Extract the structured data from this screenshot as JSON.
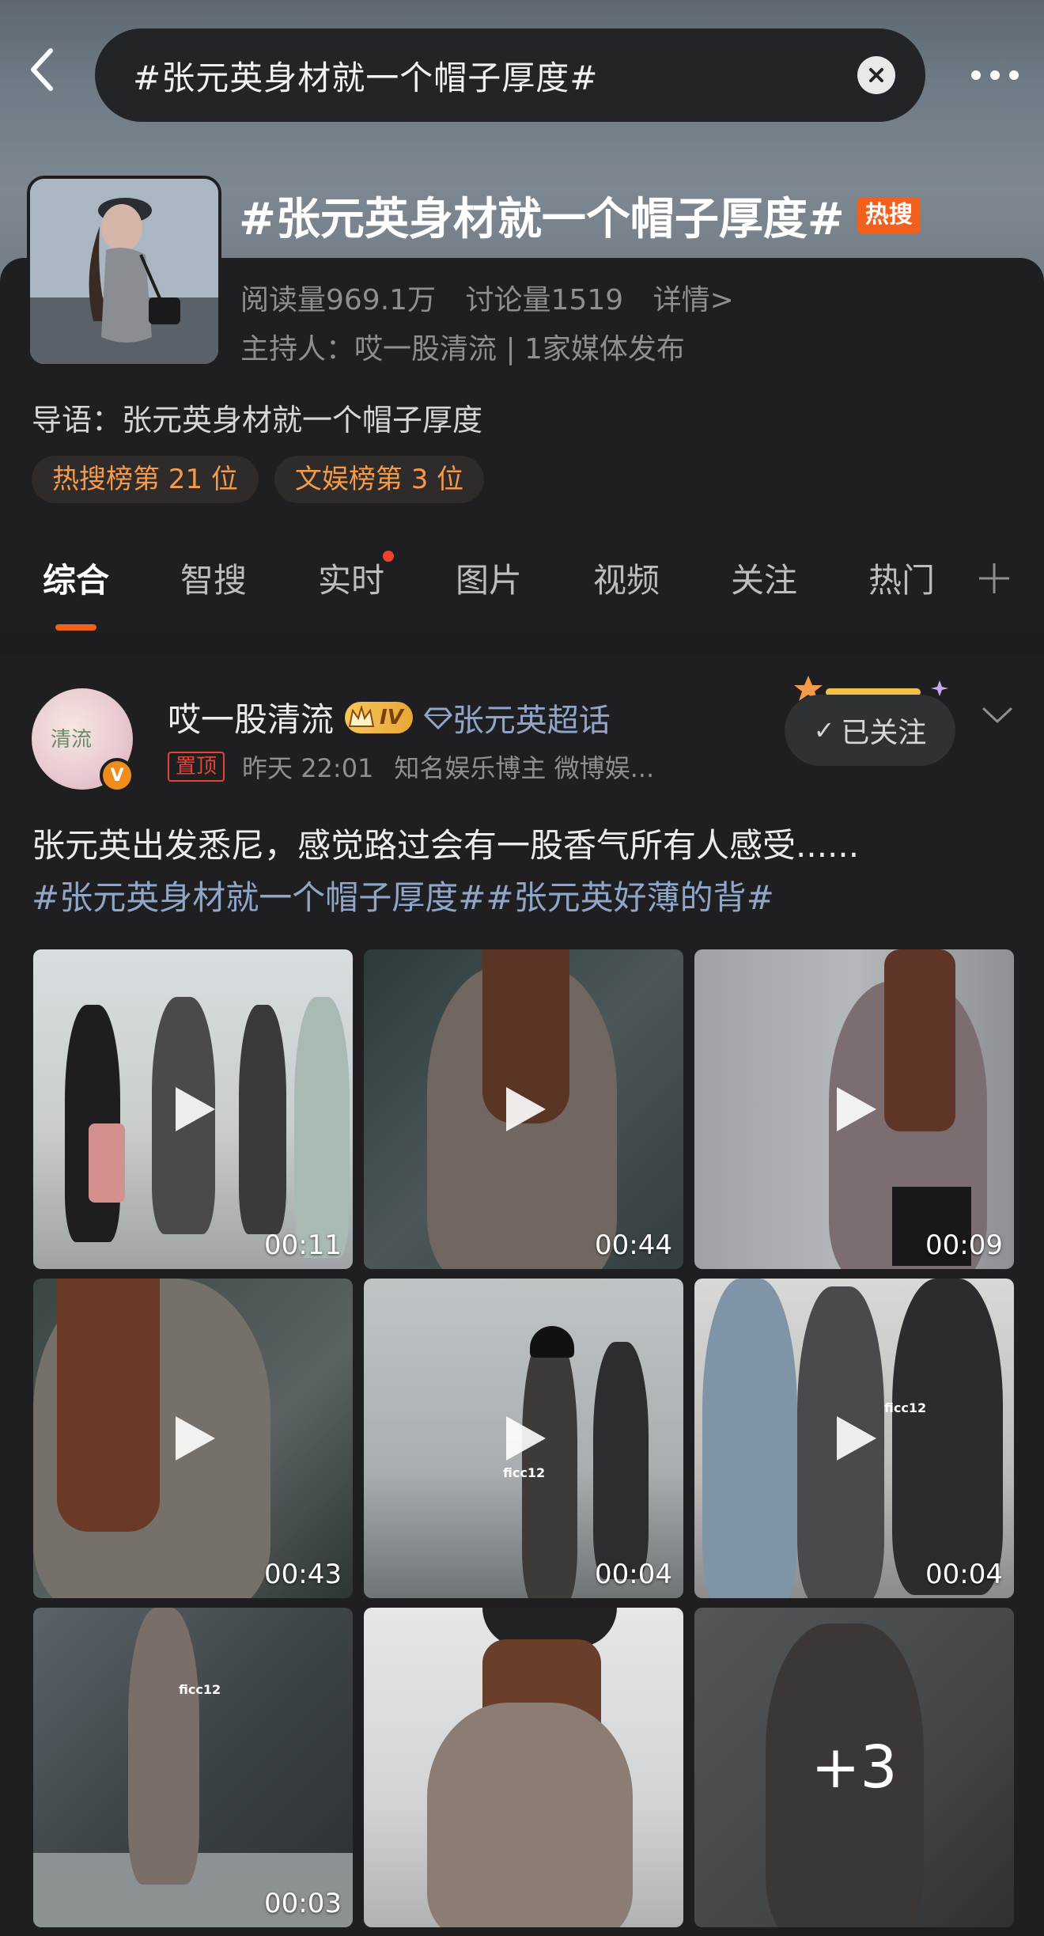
{
  "search": {
    "query": "#张元英身材就一个帽子厚度#"
  },
  "topic": {
    "title": "#张元英身材就一个帽子厚度#",
    "hot_badge": "热搜",
    "reads": "阅读量969.1万",
    "discussions": "讨论量1519",
    "details_link": "详情>",
    "host": "主持人：哎一股清流 | 1家媒体发布",
    "intro": "导语：张元英身材就一个帽子厚度",
    "rank_tags": [
      "热搜榜第 21 位",
      "文娱榜第 3 位"
    ]
  },
  "tabs": [
    {
      "label": "综合",
      "active": true,
      "dot": false
    },
    {
      "label": "智搜",
      "active": false,
      "dot": false
    },
    {
      "label": "实时",
      "active": false,
      "dot": true
    },
    {
      "label": "图片",
      "active": false,
      "dot": false
    },
    {
      "label": "视频",
      "active": false,
      "dot": false
    },
    {
      "label": "关注",
      "active": false,
      "dot": false
    },
    {
      "label": "热门",
      "active": false,
      "dot": false
    }
  ],
  "post": {
    "author": "哎一股清流",
    "avatar_text": "清流",
    "verified_mark": "V",
    "level_badge": "IV",
    "super_topic": "张元英超话",
    "pinned_label": "置顶",
    "time": "昨天 22:01",
    "author_desc": "知名娱乐博主 微博娱...",
    "follow_label": "已关注",
    "text": "张元英出发悉尼，感觉路过会有一股香气所有人感受......",
    "hashtags": "#张元英身材就一个帽子厚度##张元英好薄的背#",
    "media": [
      {
        "duration": "00:11",
        "watermark": ""
      },
      {
        "duration": "00:44",
        "watermark": ""
      },
      {
        "duration": "00:09",
        "watermark": ""
      },
      {
        "duration": "00:43",
        "watermark": ""
      },
      {
        "duration": "00:04",
        "watermark": "ficc12"
      },
      {
        "duration": "00:04",
        "watermark": "ficc12"
      },
      {
        "duration": "00:03",
        "watermark": "ficc12"
      },
      {
        "duration": "",
        "watermark": ""
      },
      {
        "duration": "",
        "watermark": "",
        "more": "+3"
      }
    ]
  },
  "colors": {
    "accent": "#f2601d",
    "link": "#8fa6c8",
    "rank_text": "#f39b4a",
    "background": "#1f1f21"
  }
}
